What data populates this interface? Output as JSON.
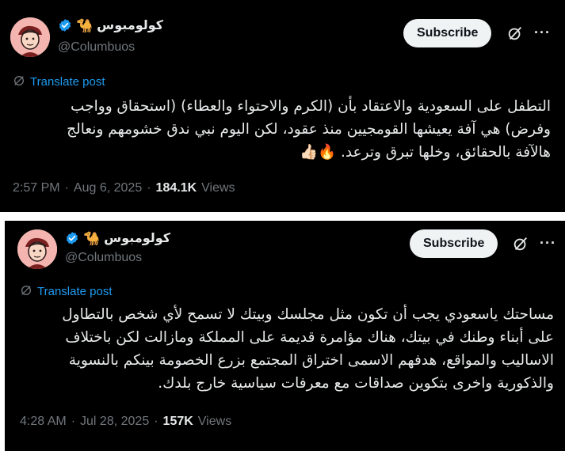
{
  "tweets": [
    {
      "display_name": "كولومبوس",
      "handle": "@Columbuos",
      "subscribe_label": "Subscribe",
      "more_label": "···",
      "translate_label": "Translate post",
      "body_lines": [
        "التطفل على السعودية والاعتقاد بأن (الكرم والاحتواء والعطاء) (استحقاق وواجب",
        "وفرض) هي آفة يعيشها القومجيين منذ عقود، لكن اليوم نبي ندق خشومهم ونعالج",
        "هالآفة بالحقائق، وخلها تبرق وترعد. 🔥👍🏻"
      ],
      "time": "2:57 PM",
      "date": "Aug 6, 2025",
      "views_count": "184.1K",
      "views_label": "Views"
    },
    {
      "display_name": "كولومبوس",
      "handle": "@Columbuos",
      "subscribe_label": "Subscribe",
      "more_label": "···",
      "translate_label": "Translate post",
      "body_lines": [
        "مساحتك ياسعودي يجب أن تكون مثل مجلسك وبيتك لا تسمح لأي شخص بالتطاول",
        "على أبناء وطنك في بيتك، هناك مؤامرة قديمة على المملكة ومازالت لكن باختلاف",
        "الاساليب والمواقع، هدفهم الاسمى اختراق المجتمع بزرع الخصومة بينكم بالنسوية",
        "والذكورية واخرى بتكوين صداقات مع معرفات سياسية خارج بلدك."
      ],
      "time": "4:28 AM",
      "date": "Jul 28, 2025",
      "views_count": "157K",
      "views_label": "Views"
    }
  ],
  "colors": {
    "background": "#000000",
    "accent": "#1d9bf0",
    "muted": "#71767b",
    "text": "#e7e9ea",
    "avatar_bg": "#f4b5b0"
  },
  "icons": {
    "verified": "verified-badge-icon",
    "camel": "camel-emoji",
    "grok": "grok-icon",
    "more": "more-icon",
    "translate": "translate-icon"
  }
}
